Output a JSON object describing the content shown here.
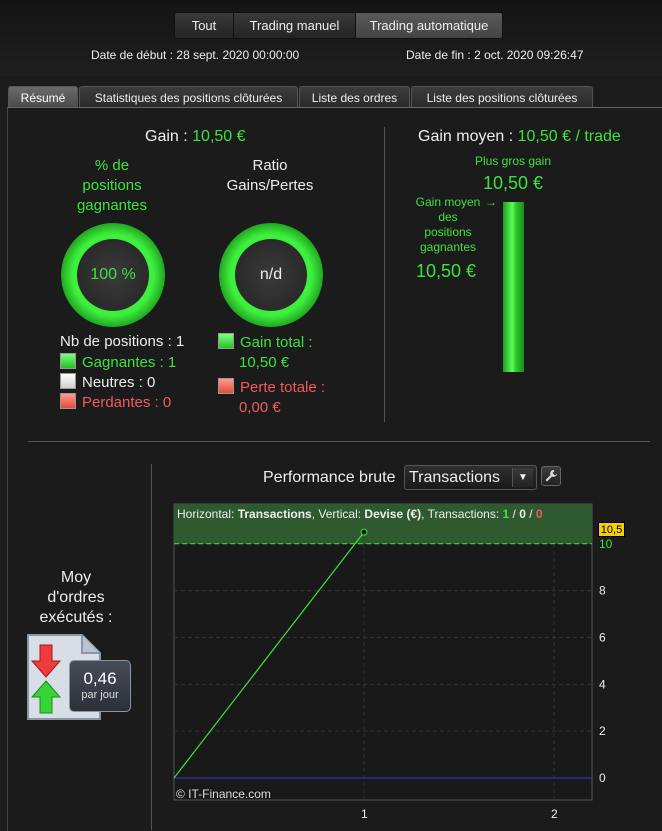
{
  "mode_tabs": [
    "Tout",
    "Trading manuel",
    "Trading automatique"
  ],
  "dates": {
    "start_label": "Date de début :",
    "start_value": "28 sept. 2020 00:00:00",
    "end_label": "Date de fin :",
    "end_value": "2 oct. 2020 09:26:47"
  },
  "tabs": [
    "Résumé",
    "Statistiques des positions clôturées",
    "Liste des ordres",
    "Liste des positions clôturées"
  ],
  "summary": {
    "gain_label": "Gain :",
    "gain_value": "10,50 €",
    "pct_label_l1": "% de",
    "pct_label_l2": "positions",
    "pct_label_l3": "gagnantes",
    "pct_value": "100 %",
    "ratio_label_l1": "Ratio",
    "ratio_label_l2": "Gains/Pertes",
    "ratio_value": "n/d",
    "nb_positions": "Nb de positions : 1",
    "winners": "Gagnantes : 1",
    "neutrals": "Neutres : 0",
    "losers": "Perdantes : 0",
    "gain_total_label": "Gain total :",
    "gain_total_value": "10,50 €",
    "perte_totale_label": "Perte totale :",
    "perte_totale_value": "0,00 €",
    "avg_gain_label": "Gain moyen :",
    "avg_gain_value": "10,50 € / trade",
    "biggest_gain_label": "Plus gros gain",
    "biggest_gain_value": "10,50 €",
    "avg_win_label_l1": "Gain moyen",
    "avg_win_label_l2": "des",
    "avg_win_label_l3": "positions",
    "avg_win_label_l4": "gagnantes",
    "avg_win_value": "10,50 €"
  },
  "orders": {
    "label_l1": "Moy",
    "label_l2": "d'ordres",
    "label_l3": "exécutés :",
    "value": "0,46",
    "unit": "par jour"
  },
  "performance": {
    "title": "Performance brute",
    "dropdown_value": "Transactions",
    "info_h": "Horizontal: ",
    "info_h_val": "Transactions",
    "info_v": ", Vertical: ",
    "info_v_val": "Devise (€)",
    "info_t": ", Transactions: ",
    "info_win": "1",
    "info_sep1": " / ",
    "info_neu": "0",
    "info_sep2": " / ",
    "info_los": "0",
    "watermark": "© IT-Finance.com",
    "last_value_label": "10,5"
  },
  "colors": {
    "green": "#3ee23e",
    "red": "#ef5b5b",
    "accent_yellow": "#f5d000"
  },
  "chart_data": {
    "type": "line",
    "x": [
      0,
      1
    ],
    "y": [
      0,
      10.5
    ],
    "xticks": [
      "1",
      "2"
    ],
    "yticks": [
      "0",
      "2",
      "4",
      "6",
      "8",
      "10"
    ],
    "xlim": [
      0,
      2.2
    ],
    "ylim": [
      0,
      11.7
    ],
    "reference_line": 10,
    "grid": true
  }
}
